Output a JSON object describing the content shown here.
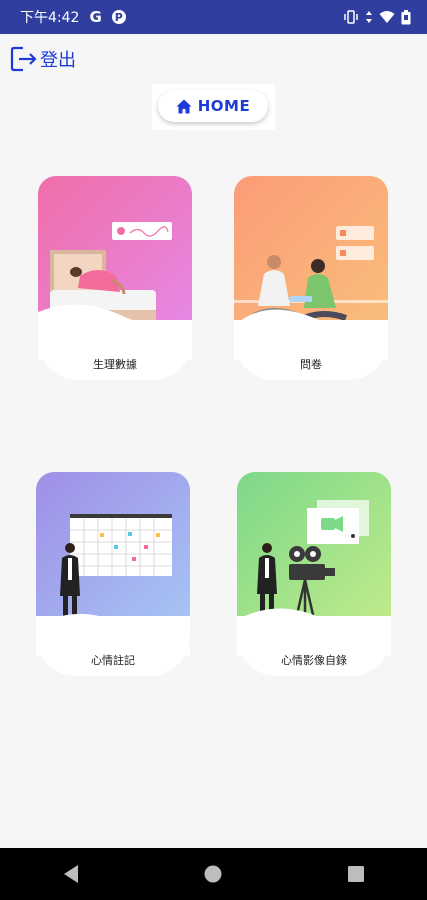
{
  "status_bar": {
    "time": "下午4:42",
    "g_label": "G",
    "p_label": "P"
  },
  "header": {
    "logout_label": "登出",
    "home_label": "HOME"
  },
  "cards": [
    {
      "label": "生理數據",
      "gradient": [
        "#f06ea8",
        "#e58ae8"
      ]
    },
    {
      "label": "問卷",
      "gradient": [
        "#fb9c78",
        "#f9c07a"
      ]
    },
    {
      "label": "心情註記",
      "gradient": [
        "#9f8ee8",
        "#a6c8f4"
      ]
    },
    {
      "label": "心情影像自錄",
      "gradient": [
        "#7dd88a",
        "#c4ec8a"
      ]
    }
  ],
  "colors": {
    "status_bar": "#303f9f",
    "accent": "#1f3bd6",
    "background": "#f6f6f6"
  }
}
